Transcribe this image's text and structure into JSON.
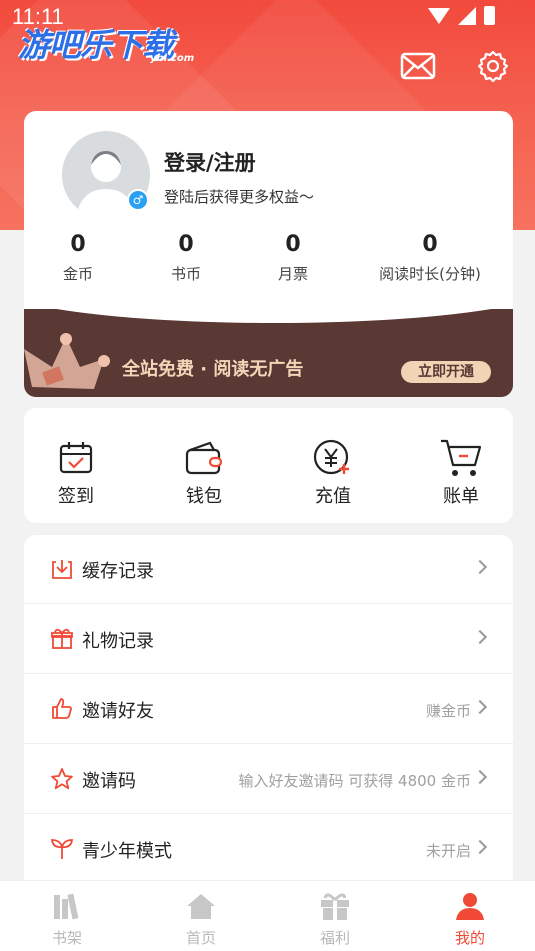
{
  "status_bar": {
    "time": "11:11"
  },
  "brand": {
    "logo_text": "游吧乐下载",
    "logo_sub": "ybl.com"
  },
  "header": {
    "mail_icon": "mail-icon",
    "settings_icon": "gear-icon"
  },
  "profile": {
    "login_title": "登录/注册",
    "login_subtitle": "登陆后获得更多权益～",
    "gender_symbol": "♂",
    "stats": [
      {
        "value": "0",
        "label": "金币"
      },
      {
        "value": "0",
        "label": "书币"
      },
      {
        "value": "0",
        "label": "月票"
      },
      {
        "value": "0",
        "label": "阅读时长(分钟)"
      }
    ]
  },
  "vip": {
    "text": "全站免费 · 阅读无广告",
    "button": "立即开通"
  },
  "actions": [
    {
      "label": "签到",
      "icon": "calendar-check-icon"
    },
    {
      "label": "钱包",
      "icon": "wallet-icon"
    },
    {
      "label": "充值",
      "icon": "yuan-plus-icon"
    },
    {
      "label": "账单",
      "icon": "cart-icon"
    }
  ],
  "menu": [
    {
      "label": "缓存记录",
      "hint": "",
      "icon": "download-icon"
    },
    {
      "label": "礼物记录",
      "hint": "",
      "icon": "gift-icon"
    },
    {
      "label": "邀请好友",
      "hint": "赚金币",
      "icon": "thumbs-up-icon"
    },
    {
      "label": "邀请码",
      "hint": "输入好友邀请码 可获得 4800 金币",
      "icon": "star-icon"
    },
    {
      "label": "青少年模式",
      "hint": "未开启",
      "icon": "sprout-icon"
    }
  ],
  "tabs": [
    {
      "label": "书架",
      "icon": "bookshelf-icon"
    },
    {
      "label": "首页",
      "icon": "home-icon"
    },
    {
      "label": "福利",
      "icon": "gift-icon"
    },
    {
      "label": "我的",
      "icon": "user-icon"
    }
  ],
  "colors": {
    "accent": "#f04a36",
    "vip_bg": "#5a3834",
    "vip_gold": "#f1d3b6"
  }
}
